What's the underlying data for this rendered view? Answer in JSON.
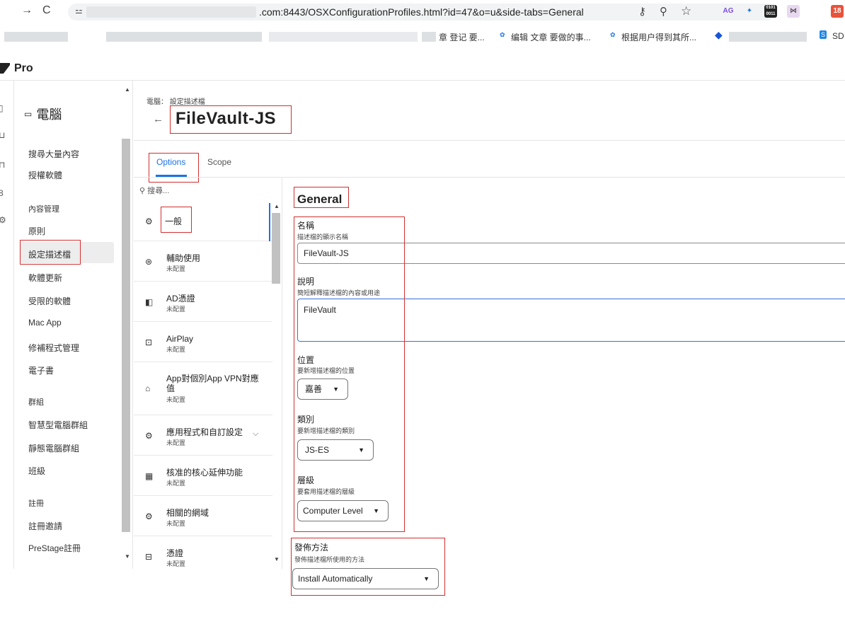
{
  "browser": {
    "url": ".com:8443/OSXConfigurationProfiles.html?id=47&o=u&side-tabs=General",
    "tab_badge": "18",
    "bookmarks": [
      "章 登记 要...",
      "编辑 文章 要做的事...",
      "根据用户得到其所...",
      "SD"
    ]
  },
  "app": {
    "title": "Pro"
  },
  "leftnav": {
    "heading": "電腦",
    "items": [
      "搜尋大量內容",
      "授權軟體"
    ],
    "content_section": "內容管理",
    "content_items": [
      "原則",
      "設定描述檔",
      "軟體更新",
      "受限的軟體",
      "Mac App",
      "修補程式管理",
      "電子書"
    ],
    "groups_section": "群組",
    "group_items": [
      "智慧型電腦群組",
      "靜態電腦群組",
      "班級"
    ],
    "enroll_section": "註冊",
    "enroll_items": [
      "註冊邀請",
      "PreStage註冊"
    ]
  },
  "page": {
    "breadcrumb": "電腦： 設定描述檔",
    "title": "FileVault-JS",
    "tabs": [
      "Options",
      "Scope"
    ]
  },
  "payloads": {
    "search_placeholder": "搜尋...",
    "items": [
      {
        "name": "一般",
        "status": ""
      },
      {
        "name": "輔助使用",
        "status": "未配置"
      },
      {
        "name": "AD憑證",
        "status": "未配置"
      },
      {
        "name": "AirPlay",
        "status": "未配置"
      },
      {
        "name": "App對個別App VPN對應",
        "name2": "值",
        "status": "未配置"
      },
      {
        "name": "應用程式和自訂設定",
        "status": "未配置"
      },
      {
        "name": "核准的核心延伸功能",
        "status": "未配置"
      },
      {
        "name": "相關的網域",
        "status": "未配置"
      },
      {
        "name": "憑證",
        "status": "未配置"
      }
    ]
  },
  "general": {
    "heading": "General",
    "name_label": "名稱",
    "name_help": "描述檔的顯示名稱",
    "name_value": "FileVault-JS",
    "desc_label": "說明",
    "desc_help": "簡短解釋描述檔的內容或用途",
    "desc_value": "FileVault",
    "site_label": "位置",
    "site_help": "要新增描述檔的位置",
    "site_value": "嘉善",
    "category_label": "類別",
    "category_help": "要新增描述檔的類別",
    "category_value": "JS-ES",
    "level_label": "層級",
    "level_help": "要套用描述檔的層級",
    "level_value": "Computer Level",
    "distribution_label": "發佈方法",
    "distribution_help": "發佈描述檔所使用的方法",
    "distribution_value": "Install Automatically"
  }
}
